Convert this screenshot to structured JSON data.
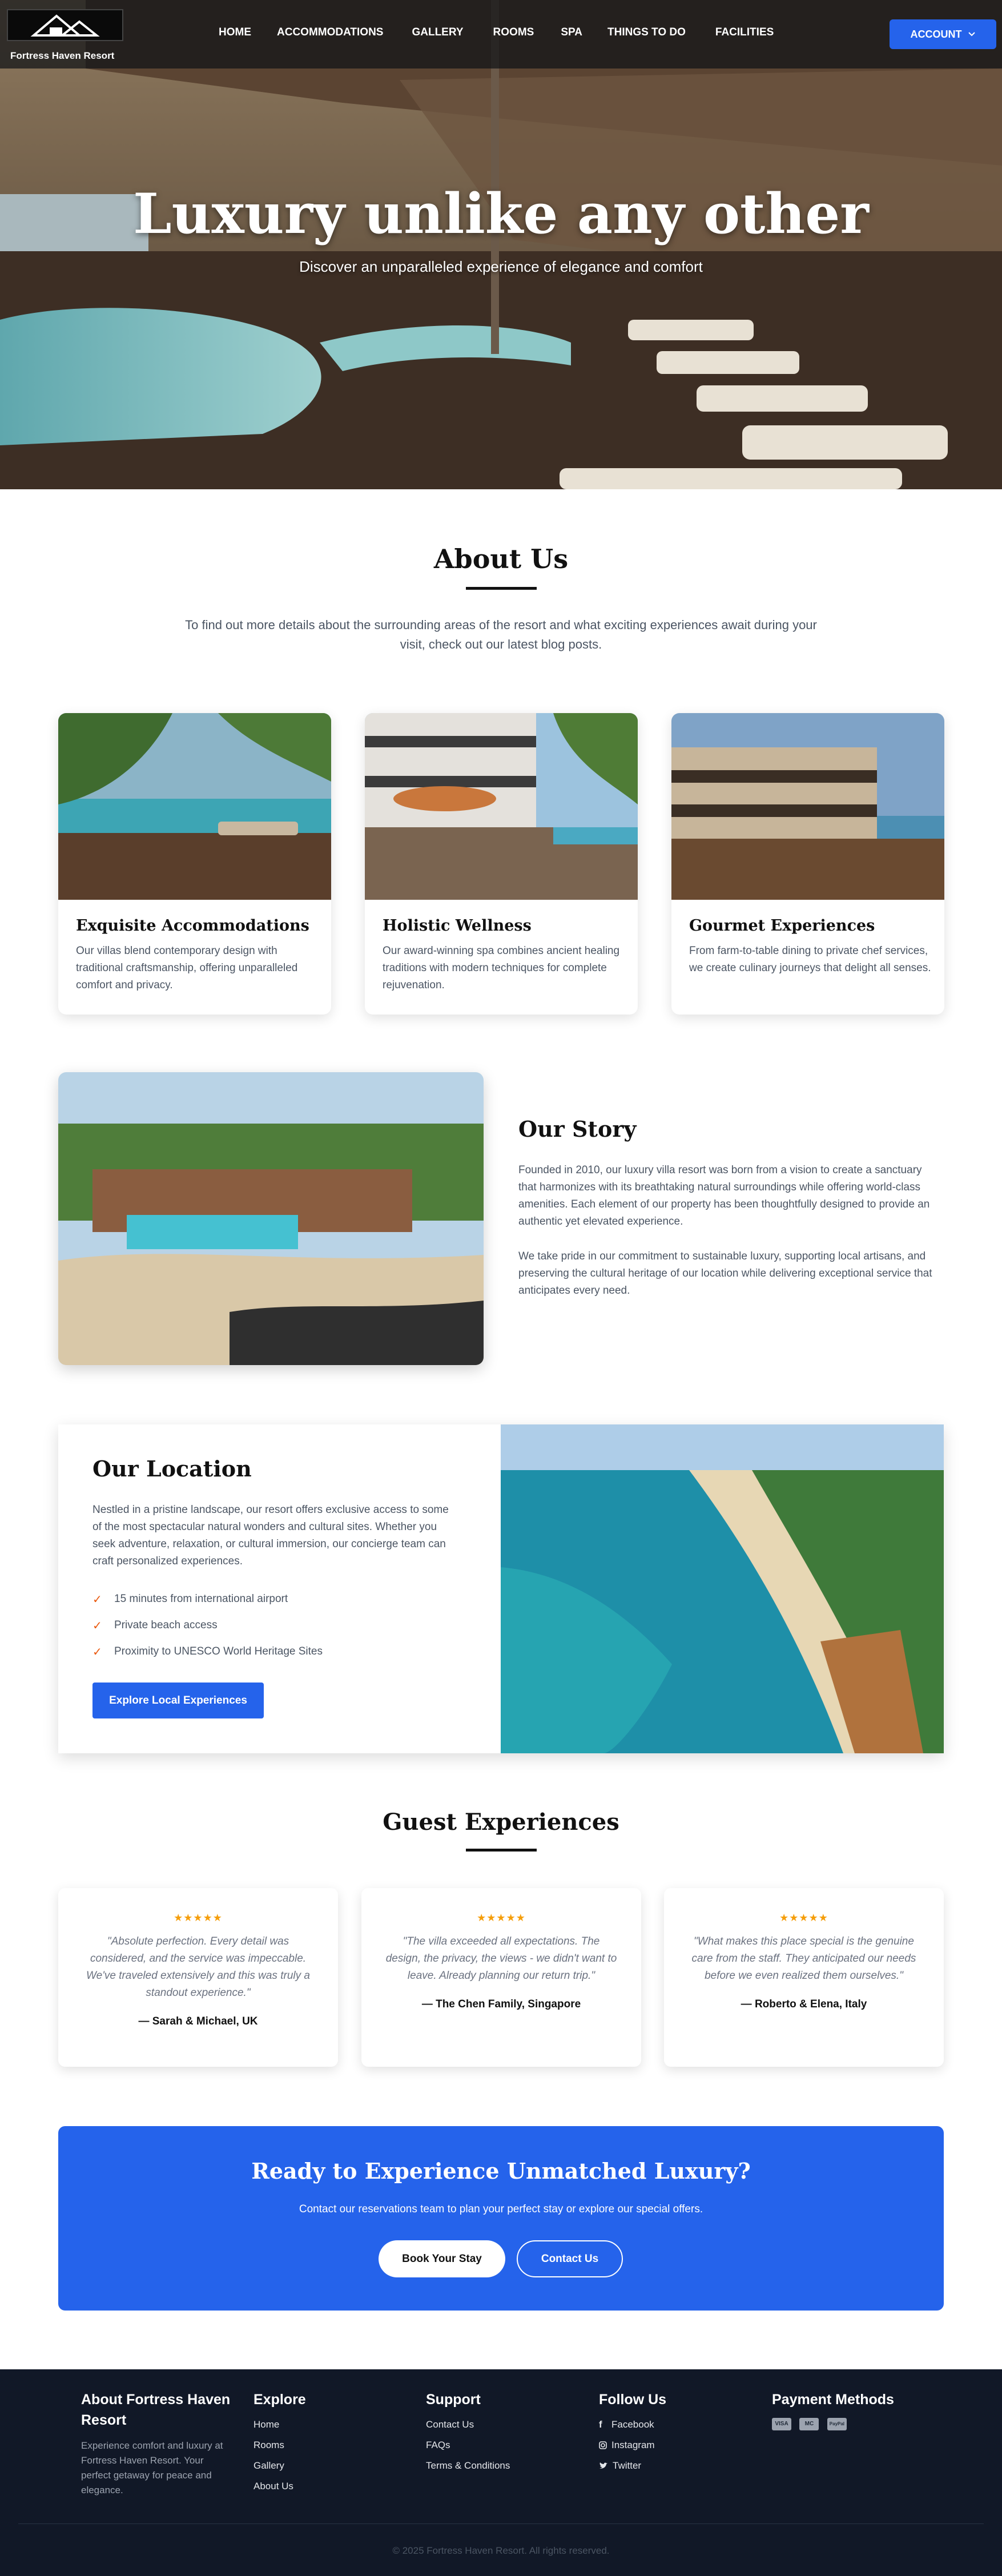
{
  "nav": {
    "brand": "Fortress Haven Resort",
    "links": [
      "HOME",
      "ACCOMMODATIONS",
      "GALLERY",
      "ROOMS",
      "SPA",
      "THINGS TO DO",
      "FACILITIES"
    ],
    "account": "ACCOUNT"
  },
  "hero": {
    "title": "Luxury unlike any other",
    "subtitle": "Discover an unparalleled experience of elegance and comfort"
  },
  "about": {
    "title": "About Us",
    "text": "To find out more details about the surrounding areas of the resort and what exciting experiences await during your visit, check out our latest blog posts."
  },
  "features": [
    {
      "title": "Exquisite Accommodations",
      "text": "Our villas blend contemporary design with traditional craftsmanship, offering unparalleled comfort and privacy."
    },
    {
      "title": "Holistic Wellness",
      "text": "Our award-winning spa combines ancient healing traditions with modern techniques for complete rejuvenation."
    },
    {
      "title": "Gourmet Experiences",
      "text": "From farm-to-table dining to private chef services, we create culinary journeys that delight all senses."
    }
  ],
  "story": {
    "title": "Our Story",
    "p1": "Founded in 2010, our luxury villa resort was born from a vision to create a sanctuary that harmonizes with its breathtaking natural surroundings while offering world-class amenities. Each element of our property has been thoughtfully designed to provide an authentic yet elevated experience.",
    "p2": "We take pride in our commitment to sustainable luxury, supporting local artisans, and preserving the cultural heritage of our location while delivering exceptional service that anticipates every need."
  },
  "location": {
    "title": "Our Location",
    "text": "Nestled in a pristine landscape, our resort offers exclusive access to some of the most spectacular natural wonders and cultural sites. Whether you seek adventure, relaxation, or cultural immersion, our concierge team can craft personalized experiences.",
    "checks": [
      "15 minutes from international airport",
      "Private beach access",
      "Proximity to UNESCO World Heritage Sites"
    ],
    "button": "Explore Local Experiences"
  },
  "guests": {
    "title": "Guest Experiences",
    "stars": "★★★★★",
    "items": [
      {
        "quote": "\"Absolute perfection. Every detail was considered, and the service was impeccable. We've traveled extensively and this was truly a standout experience.\"",
        "author": "— Sarah & Michael, UK"
      },
      {
        "quote": "\"The villa exceeded all expectations. The design, the privacy, the views - we didn't want to leave. Already planning our return trip.\"",
        "author": "— The Chen Family, Singapore"
      },
      {
        "quote": "\"What makes this place special is the genuine care from the staff. They anticipated our needs before we even realized them ourselves.\"",
        "author": "— Roberto & Elena, Italy"
      }
    ]
  },
  "cta": {
    "title": "Ready to Experience Unmatched Luxury?",
    "text": "Contact our reservations team to plan your perfect stay or explore our special offers.",
    "book": "Book Your Stay",
    "contact": "Contact Us"
  },
  "footer": {
    "about_title": "About Fortress Haven Resort",
    "about_text": "Experience comfort and luxury at Fortress Haven Resort. Your perfect getaway for peace and elegance.",
    "explore_title": "Explore",
    "explore": [
      "Home",
      "Rooms",
      "Gallery",
      "About Us"
    ],
    "support_title": "Support",
    "support": [
      "Contact Us",
      "FAQs",
      "Terms & Conditions"
    ],
    "follow_title": "Follow Us",
    "follow": [
      "Facebook",
      "Instagram",
      "Twitter"
    ],
    "payment_title": "Payment Methods",
    "payments": [
      "VISA",
      "MC",
      "PayPal"
    ],
    "copyright": "© 2025 Fortress Haven Resort. All rights reserved."
  },
  "colors": {
    "accent": "#2563eb",
    "check": "#ea580c",
    "star": "#f59e0b",
    "footer": "#111827"
  }
}
